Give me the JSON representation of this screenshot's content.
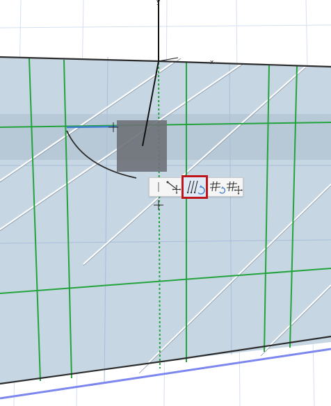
{
  "viewport": {
    "description_label": "",
    "colors": {
      "background": "#ffffff",
      "slab_fill": "#c6d6e3",
      "band_fill": "#aebfcf",
      "grid_line": "#1fa23a",
      "guide_line": "#b8c8e6",
      "edge_line": "#2b2b2b",
      "blue_edge": "#7b86ee",
      "selection_fill": "#6e7178",
      "accent_selected": "#c0151b"
    },
    "axes": {
      "y_label": "y",
      "x_label": "x"
    }
  },
  "pet_palette": {
    "items": [
      {
        "id": "separator",
        "label": "|",
        "icon": "separator-icon"
      },
      {
        "id": "move-node",
        "label": "",
        "icon": "move-node-icon"
      },
      {
        "id": "rotate-lines",
        "label": "",
        "icon": "rotate-lines-icon",
        "selected": true
      },
      {
        "id": "rotate-grid",
        "label": "",
        "icon": "rotate-grid-icon"
      },
      {
        "id": "move-grid",
        "label": "",
        "icon": "move-grid-icon"
      }
    ]
  }
}
